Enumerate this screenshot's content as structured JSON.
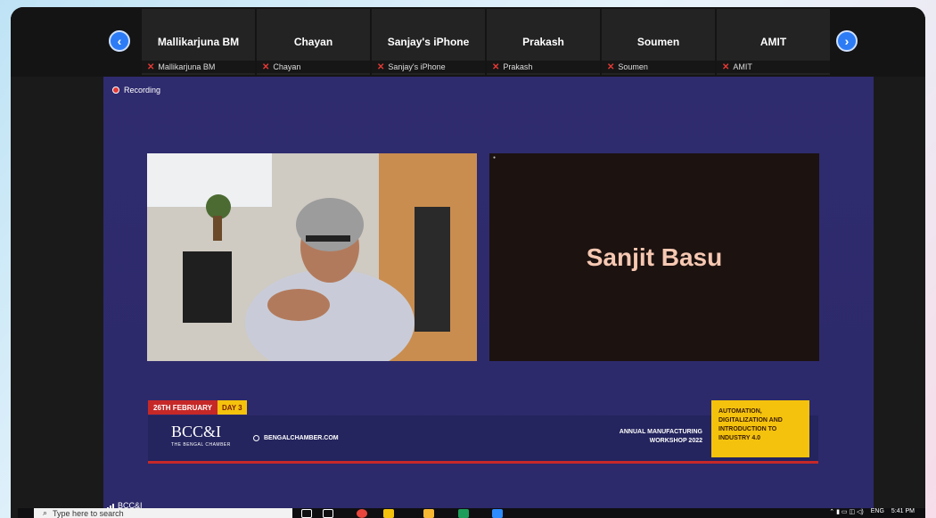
{
  "participants": [
    {
      "name": "Mallikarjuna BM",
      "label": "Mallikarjuna BM"
    },
    {
      "name": "Chayan",
      "label": "Chayan"
    },
    {
      "name": "Sanjay's iPhone",
      "label": "Sanjay's iPhone"
    },
    {
      "name": "Prakash",
      "label": "Prakash"
    },
    {
      "name": "Soumen",
      "label": "Soumen"
    },
    {
      "name": "AMIT",
      "label": "AMIT"
    }
  ],
  "recording_label": "Recording",
  "speaker_name": "Sanjit Basu",
  "banner": {
    "date": "26TH FEBRUARY",
    "day": "DAY 3",
    "logo": "BCC&I",
    "logo_sub": "THE BENGAL CHAMBER",
    "website": "BENGALCHAMBER.COM",
    "workshop_line1": "ANNUAL MANUFACTURING",
    "workshop_line2": "WORKSHOP 2022",
    "theme": "AUTOMATION, DIGITALIZATION AND INTRODUCTION TO INDUSTRY 4.0"
  },
  "connection_label": "BCC&I",
  "taskbar": {
    "search_placeholder": "Type here to search",
    "language": "ENG",
    "time": "5:41 PM"
  },
  "colors": {
    "accent_blue": "#2d7cf6",
    "stage_bg": "#2f2b6f",
    "banner_red": "#c62828",
    "banner_yellow": "#f4c20d"
  }
}
